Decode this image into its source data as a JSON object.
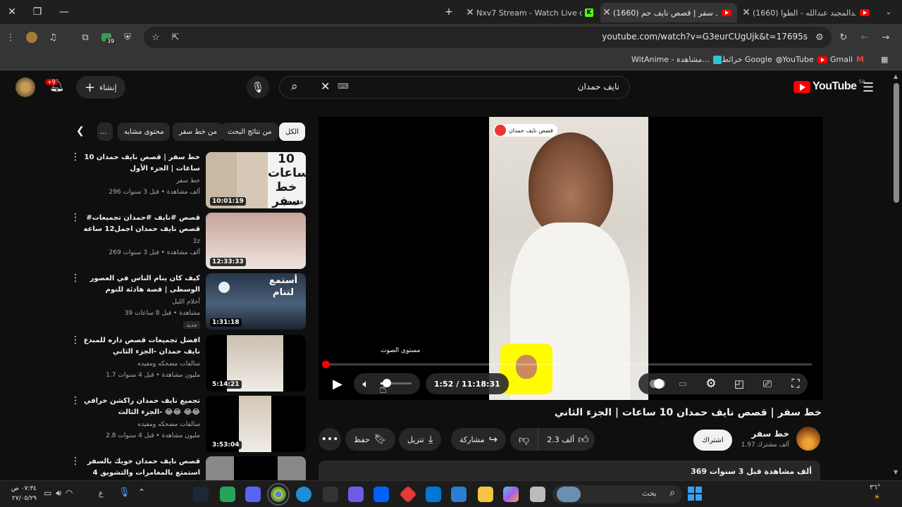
{
  "browser": {
    "tabs": [
      {
        "label": "(1660) عبدالمجيد عبدالله - الطوا",
        "favicon": "youtube-icon"
      },
      {
        "label": "(1660) خط سفر | قصص نايف حم",
        "favicon": "youtube-icon",
        "active": true
      },
      {
        "label": "Nxv7 Stream - Watch Live on K",
        "favicon": "kick-icon"
      }
    ],
    "url": "youtube.com/watch?v=G3eurCUgUjk&t=17695s",
    "bookmarks": [
      {
        "label": "Gmail",
        "icon": "gmail-icon"
      },
      {
        "label": "YouTube",
        "icon": "youtube-icon"
      },
      {
        "label": "خرائط Google",
        "icon": "maps-icon"
      },
      {
        "label": "WitAnime - مشاهدة...",
        "icon": "witanime-icon"
      }
    ],
    "extension_badge": "39"
  },
  "youtube": {
    "logo_text": "YouTube",
    "region": "SA",
    "search_query": "نايف حمدان",
    "create_label": "إنشاء",
    "notifications_badge": "+9",
    "chips": [
      "الكل",
      "من نتائج البحث",
      "من خط سفر",
      "محتوى مشابه"
    ]
  },
  "player": {
    "channel_overlay": "قصص نايف حمدان",
    "volume_tooltip": "مستوى الصوت",
    "time": "1:52 / 11:18:31",
    "progress_fraction": 0.0028,
    "volume_fraction": 0.2
  },
  "video": {
    "title": "خط سفر | قصص نايف حمدان 10 ساعات | الجزء الثاني",
    "channel": "خط سفر",
    "subscribers": "1.97 ألف مشترك",
    "subscribe_label": "اشتراك",
    "likes": "2.3 ألف",
    "share_label": "مشاركة",
    "download_label": "تنزيل",
    "save_label": "حفظ",
    "views_line": "369 ألف مشاهدة  قبل 3 سنوات"
  },
  "related": [
    {
      "title": "خط سفر | قصص نايف حمدان 10 ساعات | الجزء الأول",
      "channel": "خط سفر",
      "meta": "296 ألف مشاهدة • قبل 3 سنوات",
      "duration": "10:01:19",
      "thumb_text": "10 ساعات خط سفر",
      "thumb_sub": "الجزء الأول"
    },
    {
      "title": "#قصص #نايف #حمدان تجميعات قصص نايف حمدان اجمل12 ساعه",
      "channel": "3z",
      "meta": "269 ألف مشاهدة • قبل 3 سنوات",
      "duration": "12:33:33"
    },
    {
      "title": "كيف كان ينام الناس في العصور الوسطى | قصة هادئة للنوم",
      "channel": "أحلام الليل",
      "meta": "39 مشاهدة • قبل 8 ساعات",
      "duration": "1:31:18",
      "badge": "جديد",
      "thumb_text": "أستمع لتنام"
    },
    {
      "title": "افضل تجميعات قصص داره للمبدع نايف حمدان -الجزء الثاني",
      "channel": "سالفات مضحكه ومفيده",
      "meta": "1.7 مليون مشاهدة • قبل 4 سنوات",
      "duration": "5:14:21"
    },
    {
      "title": "تجميع نايف حمدان راكشن خرافي 😂😂 -الجزء الثالث 😂😂",
      "channel": "سالفات مضحكه ومفيده",
      "meta": "2.8 مليون مشاهدة • قبل 4 سنوات",
      "duration": "3:53:04"
    },
    {
      "title": "قصص نايف حمدان خويك بالسفر استمتع بالمغامرات والتشويق 4 ساعات بدون ...",
      "channel": "",
      "meta": "",
      "duration": ""
    }
  ],
  "taskbar": {
    "search_placeholder": "بحث",
    "time": "٠٧:٣٤ ص",
    "date": "٢٧/٠٥/٢٩",
    "lang": "ع",
    "temp": "٣٦°"
  }
}
